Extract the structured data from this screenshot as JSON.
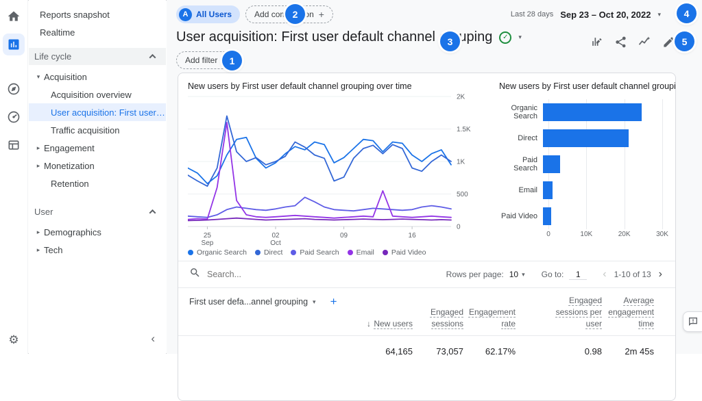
{
  "icons": {
    "tri_down": "▾",
    "tri_right": "▸",
    "check": "✓",
    "plus": "+",
    "sort_down": "↓",
    "chevron_left": "‹",
    "chevron_right": "›",
    "gear": "⚙"
  },
  "sidebar": {
    "items": {
      "reports_snapshot": "Reports snapshot",
      "realtime": "Realtime",
      "life_cycle": "Life cycle",
      "acquisition": "Acquisition",
      "acquisition_overview": "Acquisition overview",
      "user_acquisition": "User acquisition: First user ...",
      "traffic_acquisition": "Traffic acquisition",
      "engagement": "Engagement",
      "monetization": "Monetization",
      "retention": "Retention",
      "user": "User",
      "demographics": "Demographics",
      "tech": "Tech"
    }
  },
  "header": {
    "all_users_avatar": "A",
    "all_users_chip": "All Users",
    "add_comparison": "Add comparison",
    "date_preset": "Last 28 days",
    "date_range": "Sep 23 – Oct 20, 2022",
    "title": "User acquisition: First user default channel grouping",
    "add_filter": "Add filter"
  },
  "callouts": {
    "c1": "1",
    "c2": "2",
    "c3": "3",
    "c4": "4",
    "c5": "5"
  },
  "chart_data": [
    {
      "type": "line",
      "title": "New users by First user default channel grouping over time",
      "x_count": 28,
      "x_tick_positions": [
        2,
        9,
        16,
        23
      ],
      "x_tick_labels": [
        [
          "25",
          "Sep"
        ],
        [
          "02",
          "Oct"
        ],
        [
          "09",
          ""
        ],
        [
          "16",
          ""
        ]
      ],
      "ylim": [
        0,
        2000
      ],
      "y_ticks": [
        {
          "v": 0,
          "label": "0"
        },
        {
          "v": 500,
          "label": "500"
        },
        {
          "v": 1000,
          "label": "1K"
        },
        {
          "v": 1500,
          "label": "1.5K"
        },
        {
          "v": 2000,
          "label": "2K"
        }
      ],
      "series": [
        {
          "name": "Organic Search",
          "color": "#1a73e8",
          "values": [
            900,
            820,
            660,
            780,
            1100,
            1340,
            1370,
            1050,
            900,
            980,
            1120,
            1230,
            1180,
            1300,
            1260,
            980,
            1060,
            1200,
            1340,
            1320,
            1150,
            1300,
            1280,
            1100,
            1000,
            1120,
            1180,
            950
          ]
        },
        {
          "name": "Direct",
          "color": "#3367d6",
          "values": [
            790,
            700,
            620,
            900,
            1700,
            1150,
            1000,
            1060,
            950,
            1000,
            1080,
            1300,
            1220,
            1100,
            1050,
            700,
            760,
            1050,
            1200,
            1250,
            1120,
            1260,
            1200,
            900,
            850,
            1000,
            1100,
            1000
          ]
        },
        {
          "name": "Paid Search",
          "color": "#5e5ce6",
          "values": [
            160,
            150,
            140,
            180,
            260,
            300,
            280,
            260,
            250,
            270,
            300,
            320,
            450,
            380,
            300,
            260,
            250,
            240,
            260,
            280,
            270,
            260,
            250,
            260,
            300,
            320,
            300,
            270
          ]
        },
        {
          "name": "Email",
          "color": "#9334e6",
          "values": [
            110,
            120,
            115,
            600,
            1600,
            400,
            180,
            150,
            140,
            150,
            160,
            170,
            160,
            150,
            140,
            130,
            140,
            150,
            160,
            150,
            550,
            160,
            150,
            140,
            150,
            160,
            150,
            140
          ]
        },
        {
          "name": "Paid Video",
          "color": "#7627bb",
          "values": [
            90,
            95,
            100,
            110,
            120,
            130,
            120,
            110,
            100,
            105,
            110,
            115,
            120,
            110,
            105,
            100,
            105,
            110,
            115,
            110,
            105,
            110,
            115,
            110,
            105,
            100,
            105,
            100
          ]
        }
      ]
    },
    {
      "type": "bar",
      "title": "New users by First user default channel grouping",
      "categories": [
        "Organic Search",
        "Direct",
        "Paid Search",
        "Email",
        "Paid Video"
      ],
      "values": [
        26000,
        22500,
        4500,
        2600,
        2200
      ],
      "color": "#1a73e8",
      "xlim": [
        0,
        30000
      ],
      "x_ticks": [
        "0",
        "10K",
        "20K",
        "30K"
      ]
    }
  ],
  "table": {
    "search_placeholder": "Search...",
    "rows_per_page_label": "Rows per page:",
    "rows_per_page_value": "10",
    "goto_label": "Go to:",
    "goto_value": "1",
    "range_label": "1-10 of 13",
    "dimension_header": "First user defa...annel grouping",
    "add_column": "+",
    "columns": [
      "New users",
      "Engaged\nsessions",
      "Engagement\nrate",
      "Engaged\nsessions per\nuser",
      "Average\nengagement\ntime"
    ],
    "totals": [
      "64,165",
      "73,057",
      "62.17%",
      "0.98",
      "2m 45s"
    ]
  }
}
